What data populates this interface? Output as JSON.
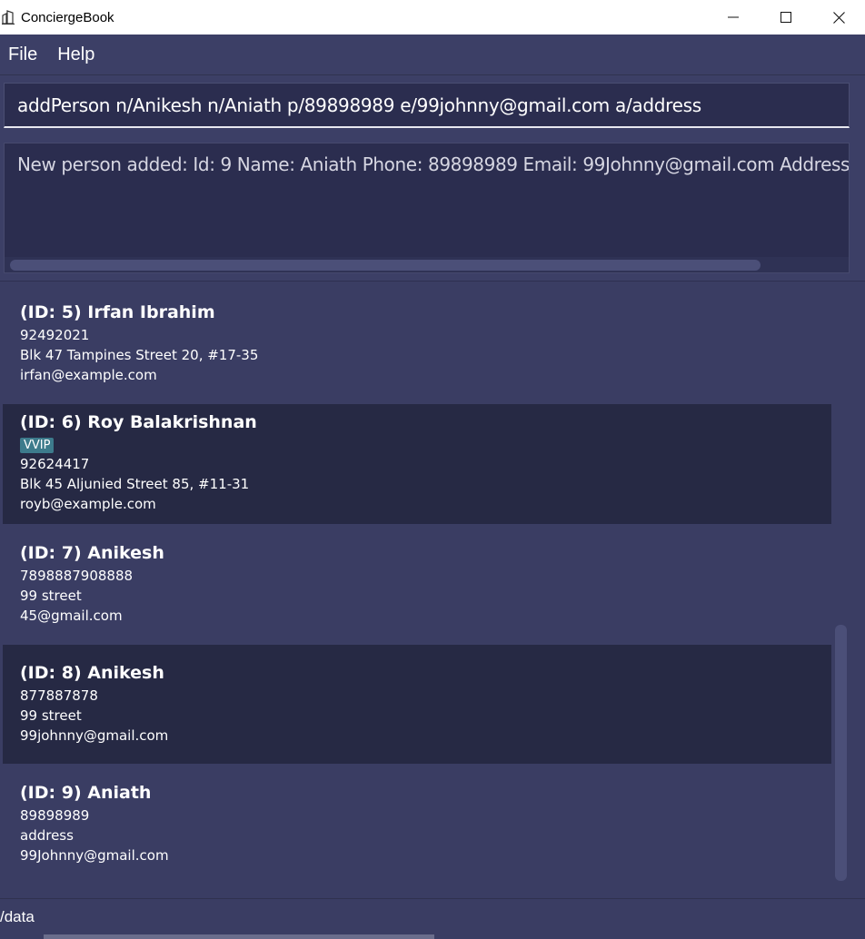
{
  "window": {
    "title": "ConciergeBook",
    "app_icon": "building-icon",
    "minimize_icon": "minimize-icon",
    "maximize_icon": "maximize-icon",
    "close_icon": "close-icon"
  },
  "menu": {
    "file_label": "File",
    "help_label": "Help"
  },
  "command": {
    "value": "addPerson n/Anikesh n/Aniath p/89898989 e/99johnny@gmail.com a/address"
  },
  "result": {
    "text": "New person added: Id: 9 Name: Aniath Phone: 89898989 Email: 99Johnny@gmail.com Address: addr"
  },
  "persons": [
    {
      "name": "(ID: 5) Irfan Ibrahim",
      "phone": "92492021",
      "address": "Blk 47 Tampines Street 20, #17-35",
      "email": "irfan@example.com"
    },
    {
      "name": "(ID: 6) Roy Balakrishnan",
      "tag": "VVIP",
      "phone": "92624417",
      "address": "Blk 45 Aljunied Street 85, #11-31",
      "email": "royb@example.com"
    },
    {
      "name": "(ID: 7) Anikesh",
      "phone": "7898887908888",
      "address": "99 street",
      "email": "45@gmail.com"
    },
    {
      "name": "(ID: 8) Anikesh",
      "phone": "877887878",
      "address": "99 street",
      "email": "99johnny@gmail.com"
    },
    {
      "name": "(ID: 9) Aniath",
      "phone": "89898989",
      "address": "address",
      "email": "99Johnny@gmail.com"
    }
  ],
  "status": {
    "path": "/data"
  },
  "colors": {
    "background": "#3a3d63",
    "card_dark": "#262944",
    "tag": "#3d7b8c"
  }
}
